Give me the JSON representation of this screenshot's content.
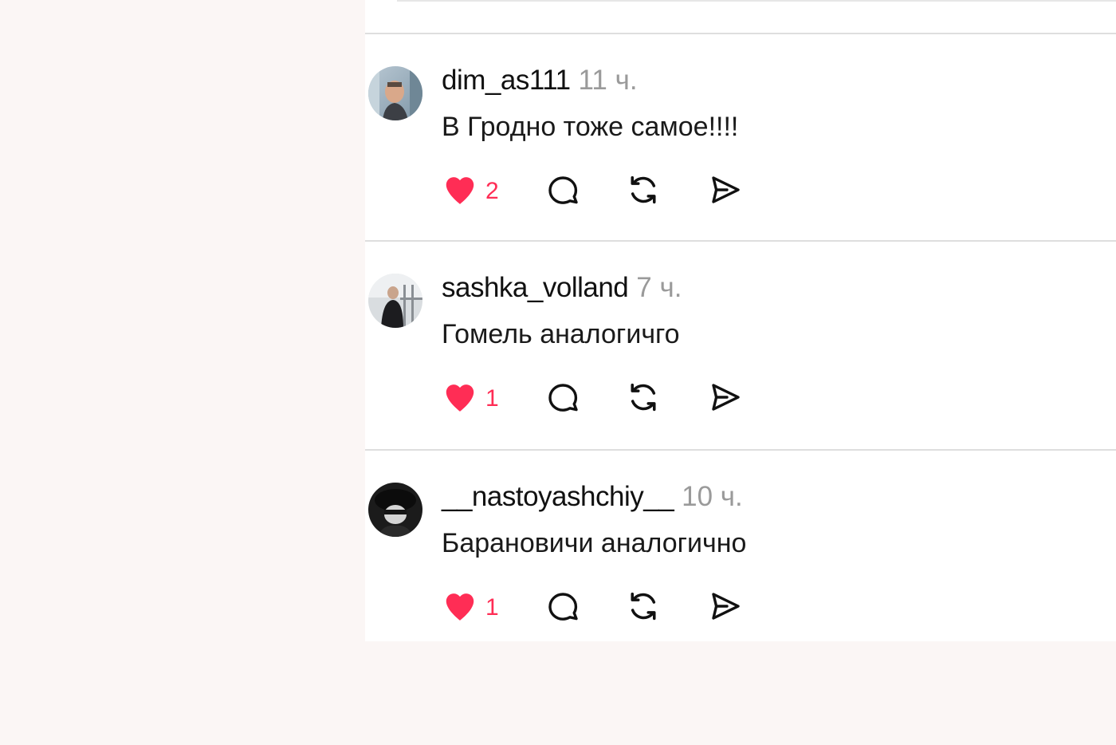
{
  "colors": {
    "like_red": "#ff2d55",
    "background": "#fbf6f5",
    "panel": "#ffffff",
    "text": "#111111",
    "muted": "#9a9a9a"
  },
  "posts": [
    {
      "username": "dim_as111",
      "time": "11 ч.",
      "text": "В Гродно тоже самое!!!!",
      "likes": "2",
      "icons": [
        "heart-filled-icon",
        "comment-icon",
        "repost-icon",
        "share-icon"
      ]
    },
    {
      "username": "sashka_volland",
      "time": "7 ч.",
      "text": "Гомель аналогичго",
      "likes": "1",
      "icons": [
        "heart-filled-icon",
        "comment-icon",
        "repost-icon",
        "share-icon"
      ]
    },
    {
      "username": "__nastoyashchiy__",
      "time": "10 ч.",
      "text": "Барановичи аналогично",
      "likes": "1",
      "icons": [
        "heart-filled-icon",
        "comment-icon",
        "repost-icon",
        "share-icon"
      ]
    }
  ]
}
